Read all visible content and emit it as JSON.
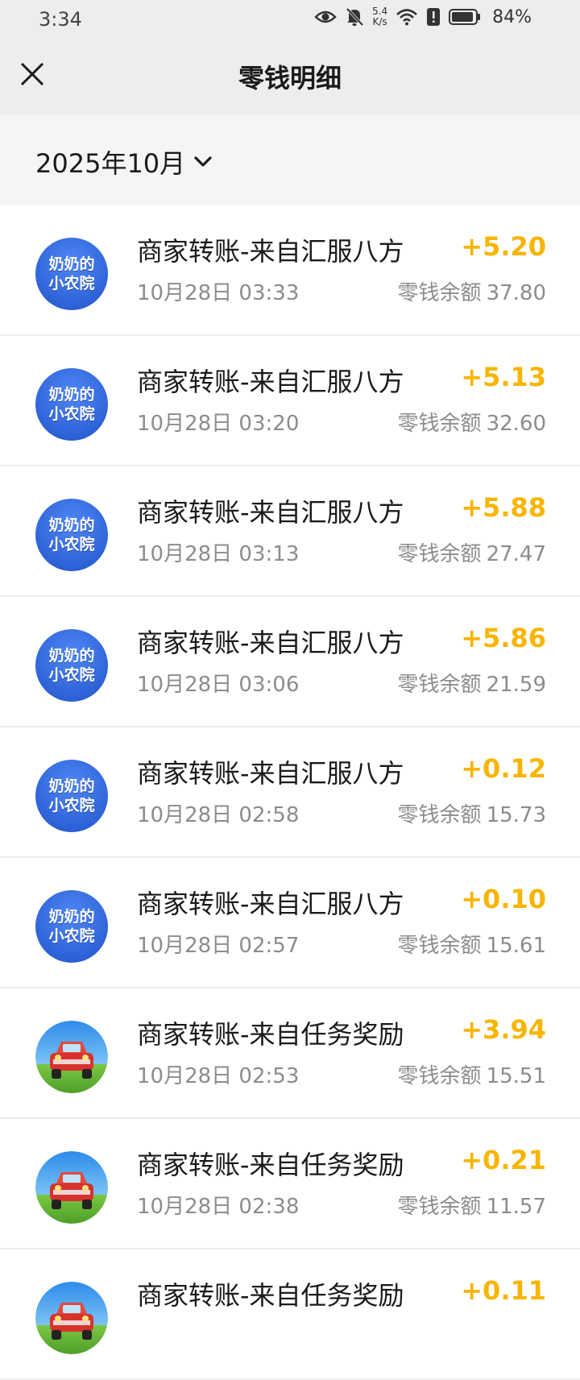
{
  "status": {
    "time": "3:34",
    "speed_value": "5.4",
    "speed_unit": "K/s",
    "battery": "84%"
  },
  "nav": {
    "title": "零钱明细"
  },
  "filter": {
    "month": "2025年10月"
  },
  "colors": {
    "amount": "#f7b500",
    "header_bg": "#ededed"
  },
  "transactions": [
    {
      "avatar": "shop",
      "avatar_text_1": "奶奶的",
      "avatar_text_2": "小农院",
      "title": "商家转账-来自汇服八方",
      "time": "10月28日 03:33",
      "amount": "+5.20",
      "balance_label": "零钱余额",
      "balance": "37.80"
    },
    {
      "avatar": "shop",
      "avatar_text_1": "奶奶的",
      "avatar_text_2": "小农院",
      "title": "商家转账-来自汇服八方",
      "time": "10月28日 03:20",
      "amount": "+5.13",
      "balance_label": "零钱余额",
      "balance": "32.60"
    },
    {
      "avatar": "shop",
      "avatar_text_1": "奶奶的",
      "avatar_text_2": "小农院",
      "title": "商家转账-来自汇服八方",
      "time": "10月28日 03:13",
      "amount": "+5.88",
      "balance_label": "零钱余额",
      "balance": "27.47"
    },
    {
      "avatar": "shop",
      "avatar_text_1": "奶奶的",
      "avatar_text_2": "小农院",
      "title": "商家转账-来自汇服八方",
      "time": "10月28日 03:06",
      "amount": "+5.86",
      "balance_label": "零钱余额",
      "balance": "21.59"
    },
    {
      "avatar": "shop",
      "avatar_text_1": "奶奶的",
      "avatar_text_2": "小农院",
      "title": "商家转账-来自汇服八方",
      "time": "10月28日 02:58",
      "amount": "+0.12",
      "balance_label": "零钱余额",
      "balance": "15.73"
    },
    {
      "avatar": "shop",
      "avatar_text_1": "奶奶的",
      "avatar_text_2": "小农院",
      "title": "商家转账-来自汇服八方",
      "time": "10月28日 02:57",
      "amount": "+0.10",
      "balance_label": "零钱余额",
      "balance": "15.61"
    },
    {
      "avatar": "car",
      "title": "商家转账-来自任务奖励",
      "time": "10月28日 02:53",
      "amount": "+3.94",
      "balance_label": "零钱余额",
      "balance": "15.51"
    },
    {
      "avatar": "car",
      "title": "商家转账-来自任务奖励",
      "time": "10月28日 02:38",
      "amount": "+0.21",
      "balance_label": "零钱余额",
      "balance": "11.57"
    },
    {
      "avatar": "car",
      "title": "商家转账-来自任务奖励",
      "time": "",
      "amount": "+0.11",
      "balance_label": "",
      "balance": ""
    }
  ]
}
